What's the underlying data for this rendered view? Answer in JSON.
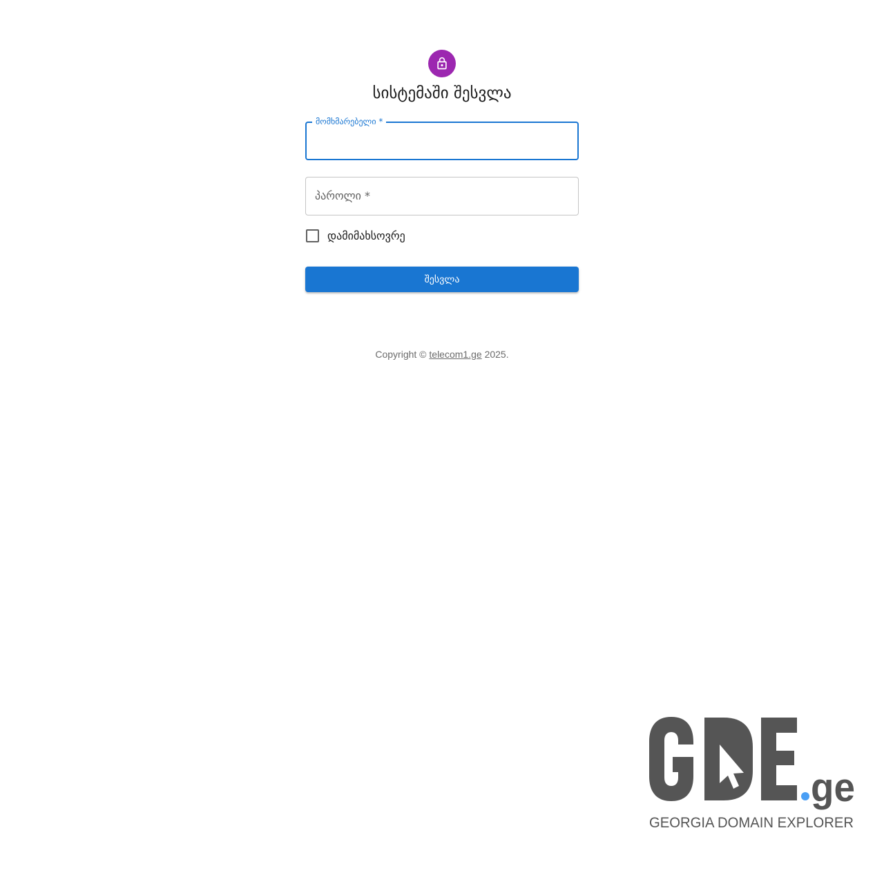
{
  "header": {
    "title": "სისტემაში შესვლა"
  },
  "form": {
    "username_label": "მომხმარებელი *",
    "username_value": "",
    "password_label": "პაროლი *",
    "password_value": "",
    "remember_label": "დამიმახსოვრე",
    "remember_checked": false,
    "submit_label": "შესვლა"
  },
  "footer": {
    "copyright_prefix": "Copyright ©",
    "copyright_link": "telecom1.ge",
    "copyright_suffix": "2025."
  },
  "logo": {
    "wordmark": "GDE",
    "tld": ".ge",
    "tagline": "GEORGIA DOMAIN EXPLORER"
  },
  "colors": {
    "avatar": "#9c27b0",
    "primary": "#1976d2",
    "logo_gray": "#555555",
    "logo_dot": "#4a9ff5"
  },
  "icons": {
    "avatar_icon": "lock-icon",
    "logo_cursor": "cursor-arrow-icon"
  }
}
